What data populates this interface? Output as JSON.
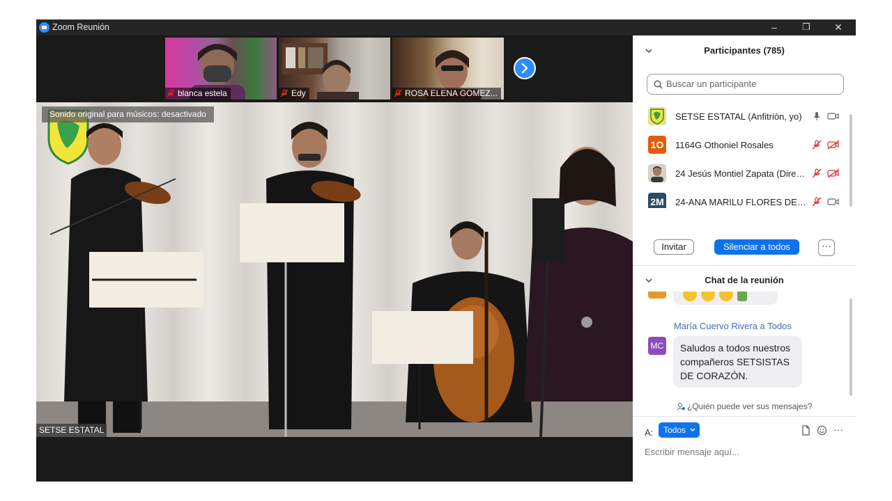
{
  "window": {
    "title": "Zoom Reunión",
    "minimize": "–",
    "restore": "❐",
    "close": "✕"
  },
  "thumbnails": [
    {
      "name": "blanca estela"
    },
    {
      "name": "Edy"
    },
    {
      "name": "ROSA ELENA GOMEZ..."
    }
  ],
  "main_video": {
    "sound_notice": "Sonido original para músicos: desactivado",
    "host_label": "SETSE ESTATAL"
  },
  "participants": {
    "header": "Participantes (785)",
    "search_placeholder": "Buscar un participante",
    "items": [
      {
        "name": "SETSE ESTATAL (Anfitrión, yo)",
        "initials": "",
        "color": "#e9e08a",
        "mic": "on",
        "camera": "on"
      },
      {
        "name": "1164G Othoniel Rosales",
        "initials": "1O",
        "color": "#e35c0c",
        "mic": "muted",
        "camera": "off"
      },
      {
        "name": "24 Jesús Montiel Zapata (Direc...",
        "initials": "",
        "color": "#b8a898",
        "mic": "muted",
        "camera": "off"
      },
      {
        "name": "24-ANA MARILU FLORES DEL A...",
        "initials": "2M",
        "color": "#2f4a63",
        "mic": "muted",
        "camera": "on"
      }
    ],
    "invite_label": "Invitar",
    "mute_all_label": "Silenciar a todos",
    "more_label": "···"
  },
  "chat": {
    "header": "Chat de la reunión",
    "sender_line": "María Cuervo Rivera a Todos",
    "sender_initials": "MC",
    "message": "Saludos a todos nuestros compañeros SETSISTAS DE CORAZÓN.",
    "who_can_see": "¿Quién puede ver sus mensajes?",
    "to_label": "A:",
    "to_value": "Todos",
    "input_placeholder": "Escribir mensaje aquí...",
    "more_label": "···"
  },
  "colors": {
    "accent": "#0e72ed",
    "muted_red": "#e02828"
  }
}
